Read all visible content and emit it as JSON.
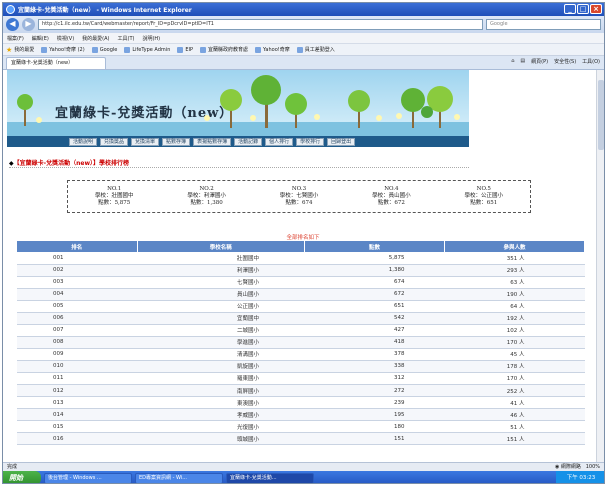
{
  "window": {
    "title": "宜蘭綠卡-兌獎活動（new） - Windows Internet Explorer"
  },
  "addressbar": {
    "url": "http://c1.ilc.edu.tw/Card/webmaster/report/Fr_ID=pDcrvID=ptID=IT1",
    "search_placeholder": "Google"
  },
  "menubar": {
    "items": [
      "檔案(F)",
      "編輯(E)",
      "檢視(V)",
      "我的最愛(A)",
      "工具(T)",
      "說明(H)"
    ]
  },
  "favorites": {
    "label": "我的最愛",
    "items": [
      "Yahoo!奇摩 (2)",
      "Google",
      "LifeType Admin",
      "EIP",
      "宜蘭縣政府教育處",
      "Yahoo!奇摩",
      "員工差勤登入"
    ]
  },
  "tabs": {
    "active": "宜蘭綠卡-兌獎活動（new）",
    "tools": [
      "網頁(P)",
      "安全性(S)",
      "工具(O)"
    ]
  },
  "site": {
    "title": "宜蘭綠卡-兌獎活動（new）",
    "nav": [
      "活動說明",
      "兑換獎品",
      "兌換清單",
      "點數存簿",
      "表揚點數存簿",
      "活動記錄",
      "個人排行",
      "學校排行",
      "回歸登出"
    ]
  },
  "section": {
    "title": "【宜蘭綠卡-兌獎活動（new）】學校排行榜"
  },
  "top5": [
    {
      "rank": "NO.1",
      "school": "學校：壯圍國中",
      "points": "點數：5,875"
    },
    {
      "rank": "NO.2",
      "school": "學校：利澤國小",
      "points": "點數：1,380"
    },
    {
      "rank": "NO.3",
      "school": "學校：七賢國小",
      "points": "點數：674"
    },
    {
      "rank": "NO.4",
      "school": "學校：員山國小",
      "points": "點數：672"
    },
    {
      "rank": "NO.5",
      "school": "學校：公正國小",
      "points": "點數：651"
    }
  ],
  "list_title": "全部排名如下",
  "table": {
    "headers": [
      "排名",
      "學校名稱",
      "點數",
      "參與人數"
    ],
    "rows": [
      [
        "001",
        "壯圍國中",
        "5,875",
        "351 人"
      ],
      [
        "002",
        "利澤國小",
        "1,380",
        "293 人"
      ],
      [
        "003",
        "七賢國小",
        "674",
        "63 人"
      ],
      [
        "004",
        "員山國小",
        "672",
        "190 人"
      ],
      [
        "005",
        "公正國小",
        "651",
        "64 人"
      ],
      [
        "006",
        "宜蘭國中",
        "542",
        "192 人"
      ],
      [
        "007",
        "二城國小",
        "427",
        "102 人"
      ],
      [
        "008",
        "學進國小",
        "418",
        "170 人"
      ],
      [
        "009",
        "清溝國小",
        "378",
        "45 人"
      ],
      [
        "010",
        "凱旋國小",
        "338",
        "178 人"
      ],
      [
        "011",
        "羅東國小",
        "312",
        "170 人"
      ],
      [
        "012",
        "南屏國小",
        "272",
        "252 人"
      ],
      [
        "013",
        "東澳國小",
        "239",
        "41 人"
      ],
      [
        "014",
        "孝威國小",
        "195",
        "46 人"
      ],
      [
        "015",
        "光復國小",
        "180",
        "51 人"
      ],
      [
        "016",
        "頭城國小",
        "151",
        "151 人"
      ]
    ]
  },
  "statusbar": {
    "left": "完成",
    "zone": "網際網路",
    "zoom": "100%"
  },
  "taskbar": {
    "start": "開始",
    "tasks": [
      "後台管理 - Windows ...",
      "ED專案資訊網 - Wi...",
      "宜蘭綠卡-兌獎活動..."
    ],
    "clock": "下午 03:23"
  }
}
